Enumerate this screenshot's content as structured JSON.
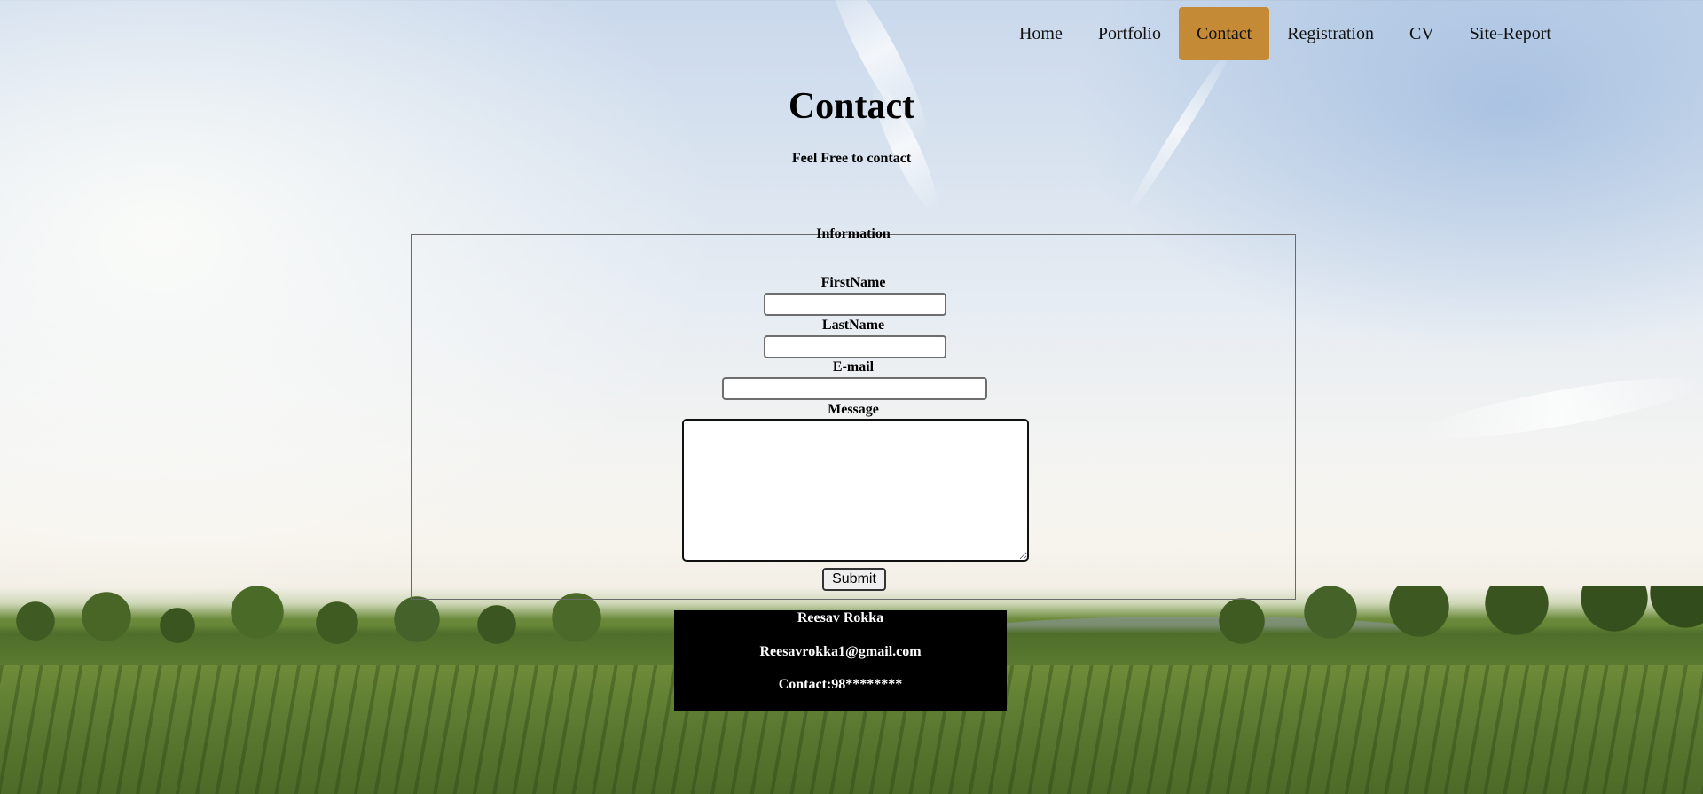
{
  "nav": {
    "items": [
      {
        "label": "Home",
        "active": false
      },
      {
        "label": "Portfolio",
        "active": false
      },
      {
        "label": "Contact",
        "active": true
      },
      {
        "label": "Registration",
        "active": false
      },
      {
        "label": "CV",
        "active": false
      },
      {
        "label": "Site-Report",
        "active": false
      }
    ],
    "active_color": "#c58a35"
  },
  "header": {
    "title": "Contact",
    "subtitle": "Feel Free to contact"
  },
  "form": {
    "legend": "Information",
    "first_name_label": "FirstName",
    "first_name_value": "",
    "last_name_label": "LastName",
    "last_name_value": "",
    "email_label": "E-mail",
    "email_value": "",
    "message_label": "Message",
    "message_value": "",
    "submit_label": "Submit"
  },
  "footer": {
    "name": "Reesav Rokka",
    "email": "Reesavrokka1@gmail.com",
    "contact": "Contact:98********"
  }
}
